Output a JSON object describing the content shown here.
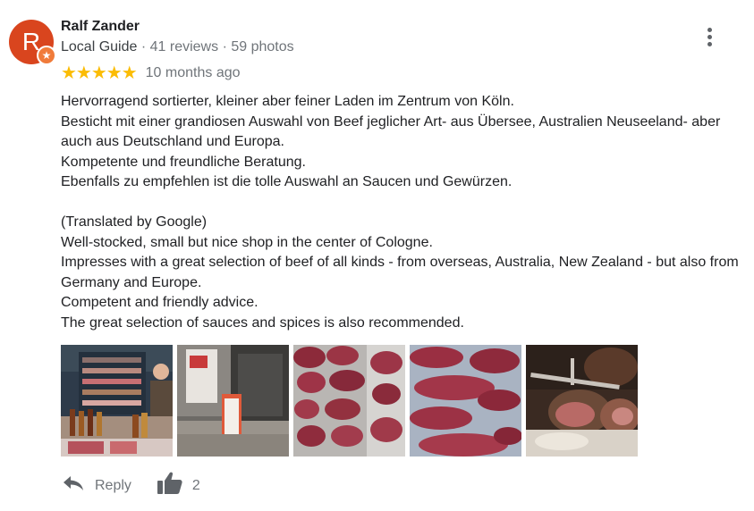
{
  "reviewer": {
    "avatar_letter": "R",
    "avatar_color": "#d9451e",
    "badge_icon": "star-icon",
    "name": "Ralf Zander",
    "guide_label": "Local Guide",
    "reviews": "41 reviews",
    "photos": "59 photos",
    "separator": "·"
  },
  "menu": {
    "icon": "more-vert-icon"
  },
  "rating": {
    "stars": 5,
    "stars_text": "★★★★★",
    "star_color": "#fbbc04",
    "time": "10 months ago"
  },
  "review_text": "Hervorragend sortierter, kleiner aber feiner Laden im Zentrum von Köln.\nBesticht mit einer grandiosen Auswahl von Beef jeglicher Art- aus Übersee, Australien Neuseeland- aber auch aus Deutschland und Europa.\nKompetente und freundliche Beratung.\nEbenfalls zu empfehlen ist die tolle Auswahl an Saucen und Gewürzen.\n\n(Translated by Google)\nWell-stocked, small but nice shop in the center of Cologne.\nImpresses with a great selection of beef of all kinds - from overseas, Australia, New Zealand - but also from Germany and Europe.\nCompetent and friendly advice.\nThe great selection of sauces and spices is also recommended.",
  "photos": [
    {
      "name": "shop-interior-photo"
    },
    {
      "name": "shop-entrance-photo"
    },
    {
      "name": "meat-display-photo"
    },
    {
      "name": "meat-cuts-photo"
    },
    {
      "name": "sliced-steak-photo"
    }
  ],
  "actions": {
    "reply_icon": "reply-icon",
    "reply_label": "Reply",
    "like_icon": "thumbs-up-icon",
    "like_count": "2"
  }
}
